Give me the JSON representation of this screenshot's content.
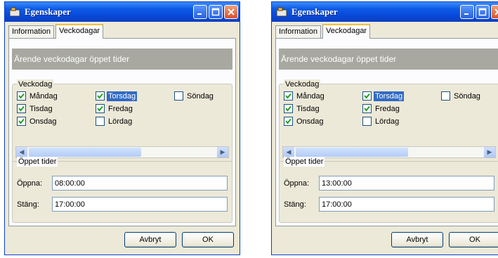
{
  "windows": [
    {
      "title": "Egenskaper",
      "tabs": [
        {
          "label": "Information"
        },
        {
          "label": "Veckodagar"
        }
      ],
      "banner": "Ärende veckodagar öppet tider",
      "days_group": {
        "legend": "Veckodag",
        "days": [
          {
            "label": "Måndag",
            "checked": true
          },
          {
            "label": "Tisdag",
            "checked": true
          },
          {
            "label": "Onsdag",
            "checked": true
          },
          {
            "label": "Torsdag",
            "checked": true
          },
          {
            "label": "Fredag",
            "checked": true
          },
          {
            "label": "Lördag",
            "checked": false
          },
          {
            "label": "Söndag",
            "checked": false
          }
        ]
      },
      "times_group": {
        "legend": "Öppet tider",
        "open_label": "Öppna:",
        "open_value": "08:00:00",
        "close_label": "Stäng:",
        "close_value": "17:00:00"
      },
      "buttons": {
        "cancel": "Avbryt",
        "ok": "OK"
      }
    },
    {
      "title": "Egenskaper",
      "tabs": [
        {
          "label": "Information"
        },
        {
          "label": "Veckodagar"
        }
      ],
      "banner": "Ärende veckodagar öppet tider",
      "days_group": {
        "legend": "Veckodag",
        "days": [
          {
            "label": "Måndag",
            "checked": true
          },
          {
            "label": "Tisdag",
            "checked": true
          },
          {
            "label": "Onsdag",
            "checked": true
          },
          {
            "label": "Torsdag",
            "checked": true
          },
          {
            "label": "Fredag",
            "checked": true
          },
          {
            "label": "Lördag",
            "checked": false
          },
          {
            "label": "Söndag",
            "checked": false
          }
        ]
      },
      "times_group": {
        "legend": "Öppet tider",
        "open_label": "Öppna:",
        "open_value": "13:00:00",
        "close_label": "Stäng:",
        "close_value": "17:00:00"
      },
      "buttons": {
        "cancel": "Avbryt",
        "ok": "OK"
      }
    }
  ],
  "colors": {
    "titlebar": "#0848d8",
    "dialog_bg": "#ece9d8",
    "banner_bg": "#a8a8a0",
    "selection": "#316ac5",
    "close_button": "#d8502a",
    "checkmark": "#21a121"
  },
  "icons": {
    "app": "properties-icon",
    "minimize": "minimize-icon",
    "maximize": "maximize-icon",
    "close": "close-icon",
    "check": "checkmark-icon",
    "scroll_left": "scroll-left-arrow-icon",
    "scroll_right": "scroll-right-arrow-icon"
  }
}
